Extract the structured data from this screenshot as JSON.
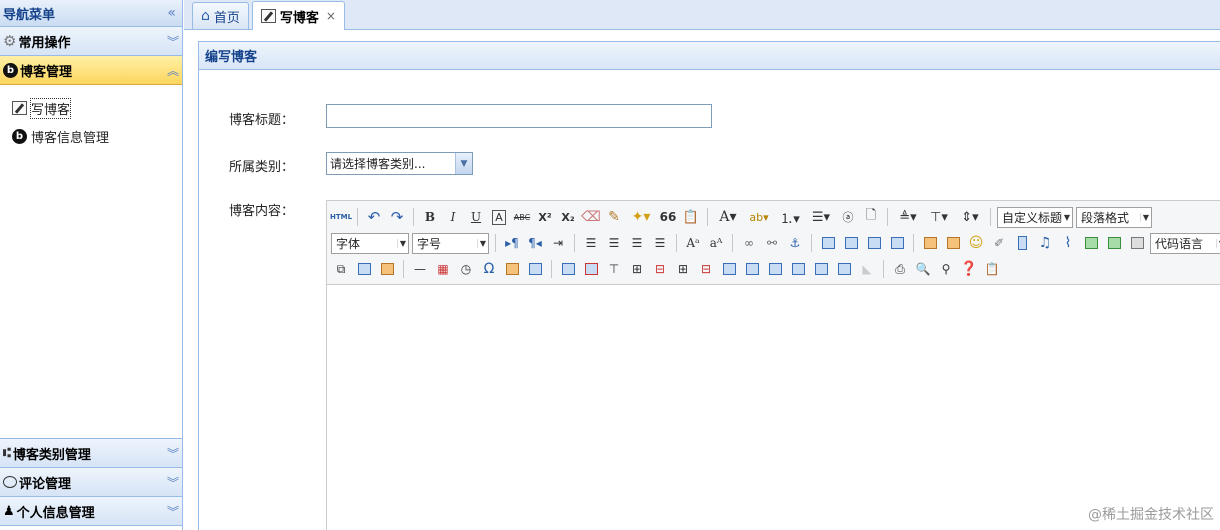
{
  "sidebar": {
    "header_title": "导航菜单",
    "collapse_glyph": "«",
    "panels": [
      {
        "label": "常用操作",
        "icon": "gear-icon",
        "chevron": "︾"
      },
      {
        "label": "博客管理",
        "icon": "blog-icon",
        "icon_glyph": "b",
        "chevron": "︽"
      }
    ],
    "menu_items": [
      {
        "label": "写博客",
        "icon": "write-blog-icon"
      },
      {
        "label": "博客信息管理",
        "icon": "blog-icon",
        "icon_glyph": "b"
      }
    ],
    "bottom_panels": [
      {
        "label": "博客类别管理",
        "icon": "tree-icon",
        "chevron": "︾"
      },
      {
        "label": "评论管理",
        "icon": "comment-icon",
        "chevron": "︾"
      },
      {
        "label": "个人信息管理",
        "icon": "user-icon",
        "chevron": "︾"
      }
    ]
  },
  "tabs": [
    {
      "label": "首页",
      "icon": "home-icon"
    },
    {
      "label": "写博客",
      "icon": "write-blog-icon",
      "close": "×"
    }
  ],
  "panel": {
    "title": "编写博客"
  },
  "form": {
    "title_label": "博客标题：",
    "title_value": "",
    "category_label": "所属类别：",
    "category_selected": "请选择博客类别...",
    "content_label": "博客内容："
  },
  "toolbar": {
    "html": "HTML",
    "bold": "B",
    "italic": "I",
    "underline": "U",
    "strikethrough": "ABC",
    "superscript": "X²",
    "subscript": "X₂",
    "quote": "66",
    "font_color": "A",
    "custom_title": "自定义标题",
    "paragraph_format": "段落格式",
    "font_family": "字体",
    "font_size": "字号",
    "code_lang": "代码语言",
    "omega": "Ω"
  },
  "watermark": "@稀土掘金技术社区",
  "colors": {
    "accent": "#15428b",
    "active_panel": "#fcd65e",
    "border": "#99bbe8"
  }
}
